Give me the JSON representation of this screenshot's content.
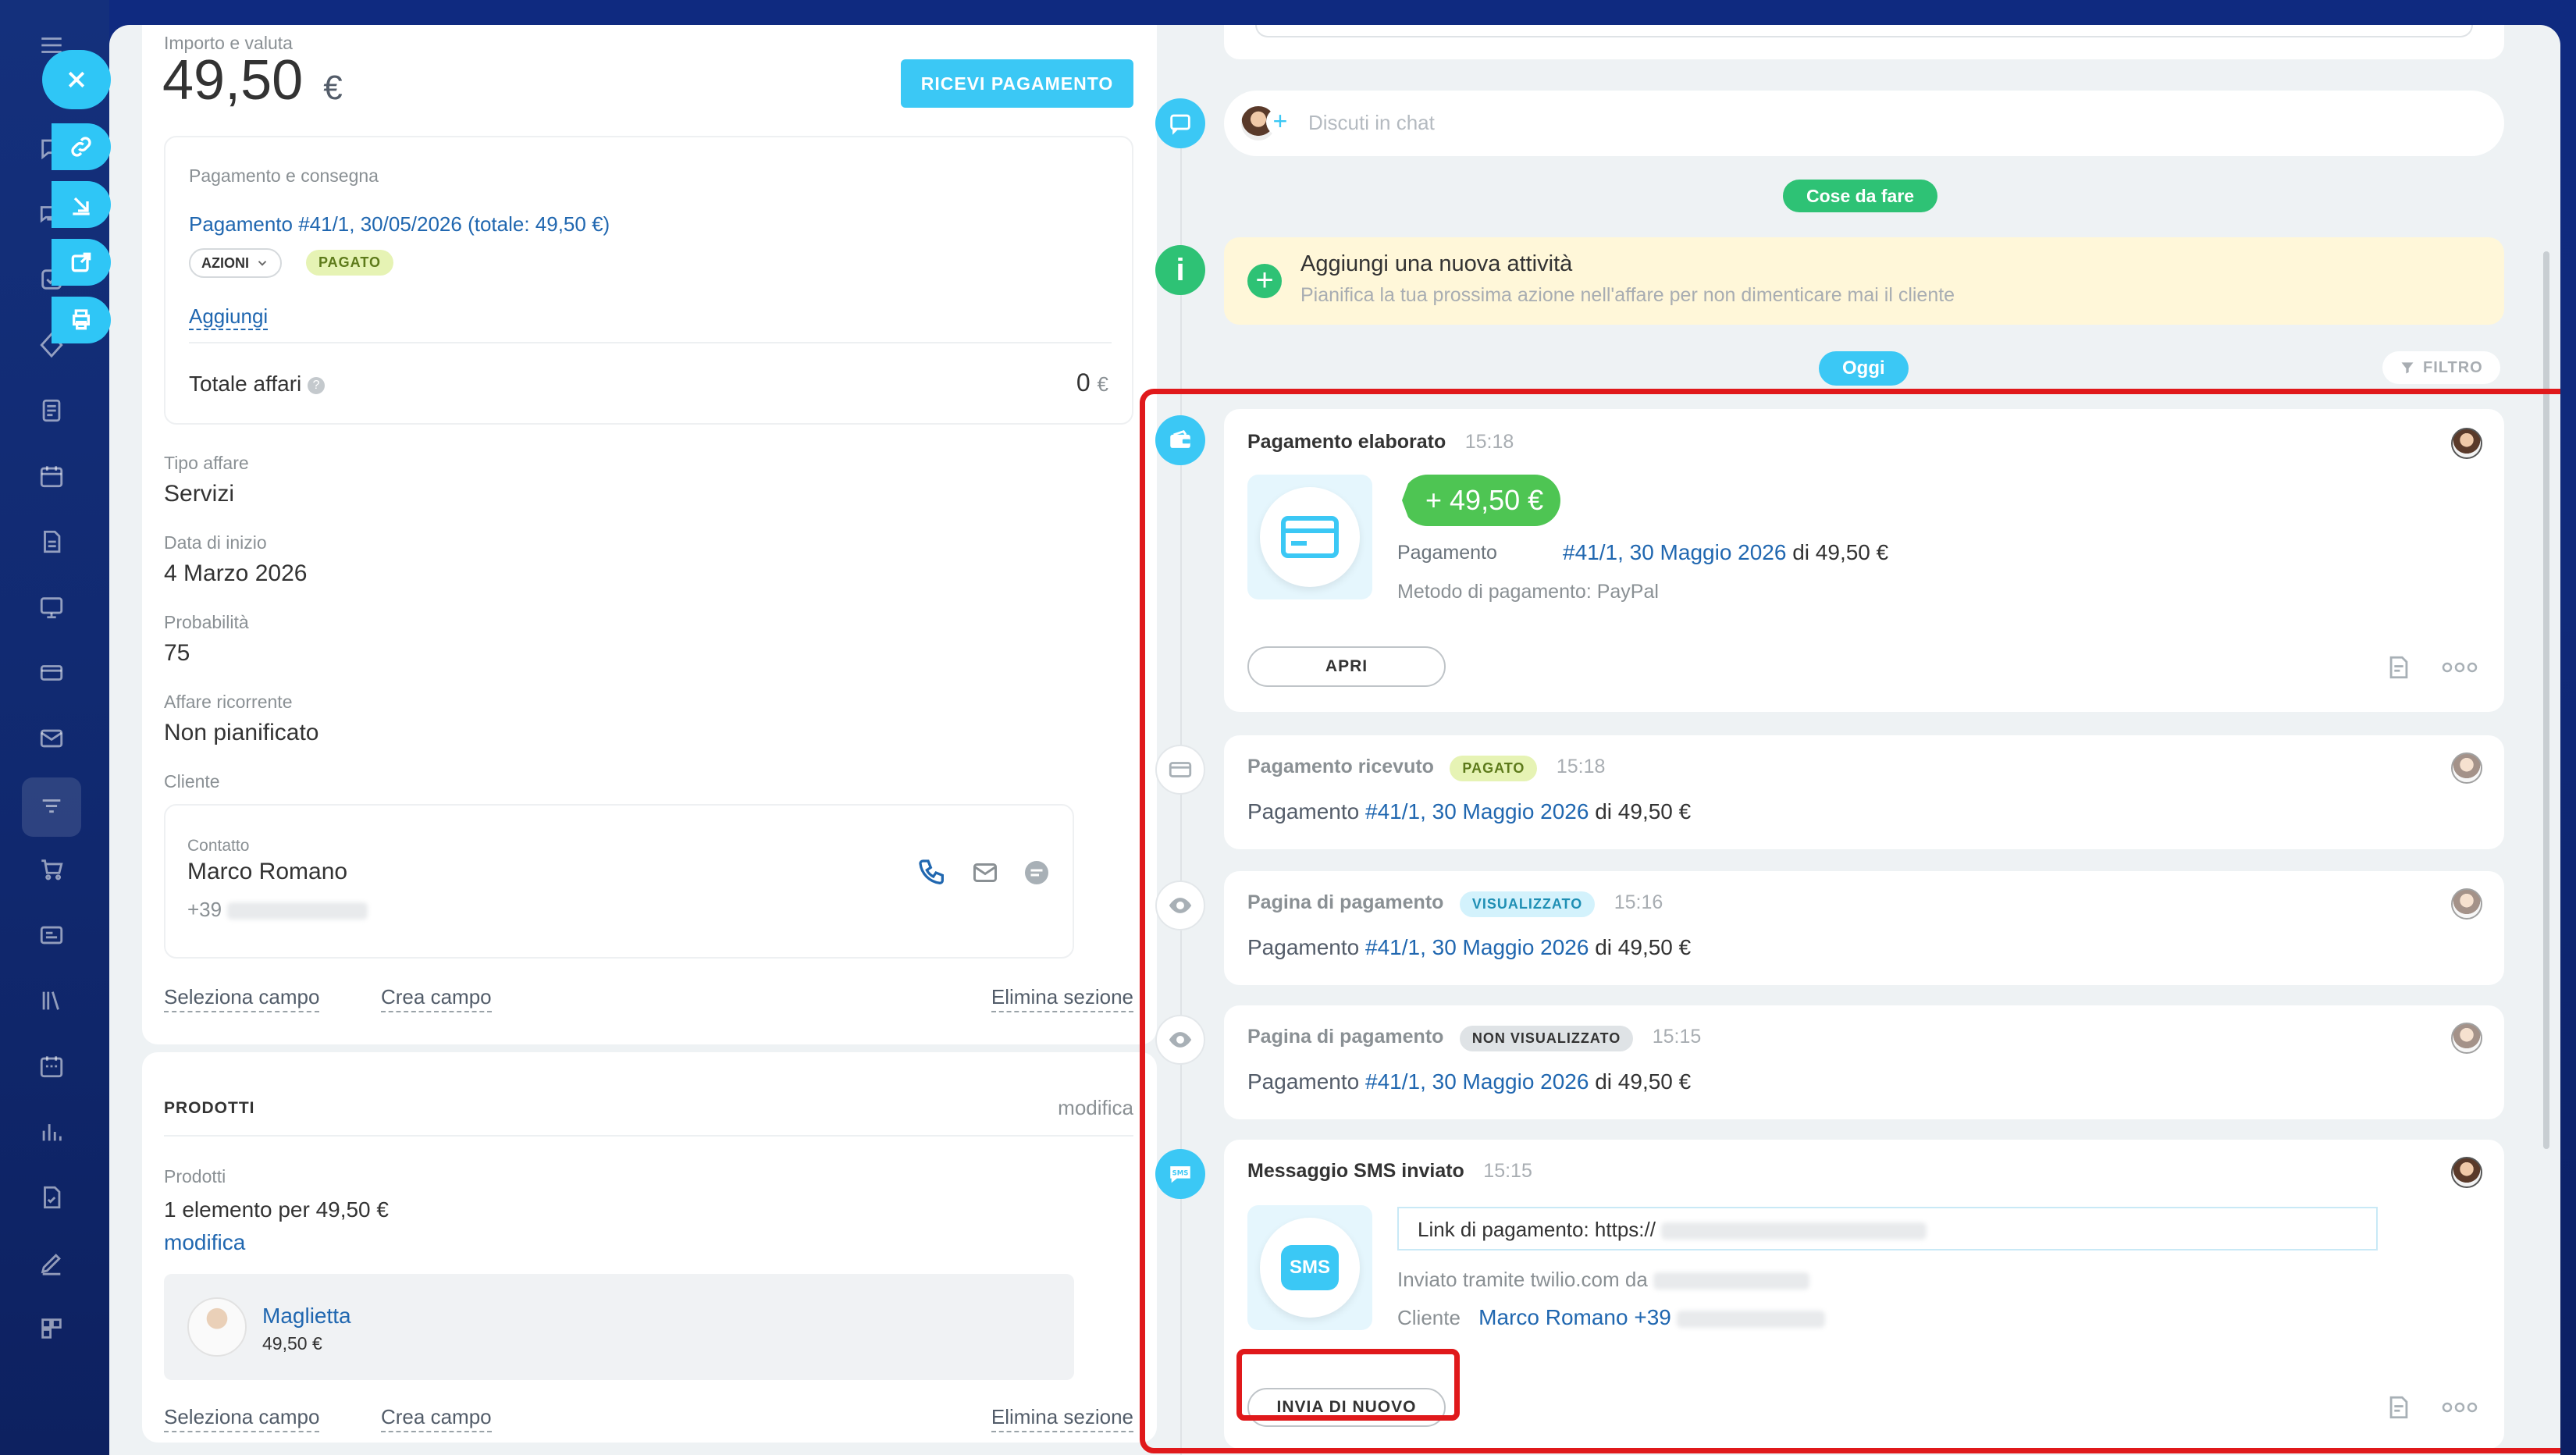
{
  "colors": {
    "accent": "#2fc6f6",
    "green": "#4ec553",
    "red_frame": "#e0191b",
    "link": "#2067b0"
  },
  "nav": {
    "icons": [
      "menu-icon",
      "chat-icon",
      "messages-icon",
      "tasks-icon",
      "sites-icon",
      "feed-icon",
      "calendar-icon",
      "documents-icon",
      "board-icon",
      "pay-icon",
      "mail-icon",
      "crm-icon",
      "shop-icon",
      "contact-center-icon",
      "library-icon",
      "schedule-icon",
      "analytics-icon",
      "automation-icon",
      "sign-icon",
      "more-icon"
    ],
    "floating": [
      "link-icon",
      "download-icon",
      "external-icon",
      "print-icon"
    ]
  },
  "left": {
    "amount_label": "Importo e valuta",
    "amount_value": "49,50",
    "amount_currency": "€",
    "receive_button": "RICEVI PAGAMENTO",
    "payment_section_label": "Pagamento e consegna",
    "payment_link": "Pagamento #41/1, 30/05/2026 (totale: 49,50 €)",
    "actions_button": "AZIONI",
    "paid_badge": "PAGATO",
    "add_link": "Aggiungi",
    "total_label": "Totale affari",
    "total_value": "0",
    "total_currency": "€",
    "fields": [
      {
        "label": "Tipo affare",
        "value": "Servizi"
      },
      {
        "label": "Data di inizio",
        "value": "4 Marzo 2026"
      },
      {
        "label": "Probabilità",
        "value": "75"
      },
      {
        "label": "Affare ricorrente",
        "value": "Non pianificato"
      }
    ],
    "client_label": "Cliente",
    "contact_label": "Contatto",
    "contact_name": "Marco Romano",
    "contact_phone_prefix": "+39",
    "select_field": "Seleziona campo",
    "create_field": "Crea campo",
    "delete_section": "Elimina sezione",
    "products_title": "PRODOTTI",
    "products_modify": "modifica",
    "products_label": "Prodotti",
    "products_summary": "1 elemento per 49,50 €",
    "products_modify_link": "modifica",
    "product_name": "Maglietta",
    "product_price": "49,50 €",
    "select_field_2": "Seleziona campo",
    "create_field_2": "Crea campo",
    "delete_section_2": "Elimina sezione"
  },
  "timeline": {
    "chat_placeholder": "Discuti in chat",
    "todo_tag": "Cose da fare",
    "new_activity_title": "Aggiungi una nuova attività",
    "new_activity_sub": "Pianifica la tua prossima azione nell'affare per non dimenticare mai il cliente",
    "today_tag": "Oggi",
    "filter_label": "FILTRO",
    "processed": {
      "title": "Pagamento elaborato",
      "time": "15:18",
      "amount": "+ 49,50 €",
      "payment_label": "Pagamento",
      "payment_link": "#41/1, 30 Maggio 2026",
      "payment_suffix": "di 49,50 €",
      "method": "Metodo di pagamento: PayPal",
      "open_button": "APRI"
    },
    "received": {
      "title": "Pagamento ricevuto",
      "badge": "PAGATO",
      "time": "15:18",
      "prefix": "Pagamento",
      "link": "#41/1, 30 Maggio 2026",
      "suffix": "di 49,50 €"
    },
    "viewed": {
      "title": "Pagina di pagamento",
      "badge": "VISUALIZZATO",
      "time": "15:16",
      "prefix": "Pagamento",
      "link": "#41/1, 30 Maggio 2026",
      "suffix": "di 49,50 €"
    },
    "notviewed": {
      "title": "Pagina di pagamento",
      "badge": "NON VISUALIZZATO",
      "time": "15:15",
      "prefix": "Pagamento",
      "link": "#41/1, 30 Maggio 2026",
      "suffix": "di 49,50 €"
    },
    "sms": {
      "title": "Messaggio SMS inviato",
      "time": "15:15",
      "sms_label": "SMS",
      "message": "Link di pagamento: https://",
      "sent_via": "Inviato tramite twilio.com da",
      "client_label": "Cliente",
      "client_value": "Marco Romano +39",
      "resend_button": "INVIA DI NUOVO"
    }
  }
}
